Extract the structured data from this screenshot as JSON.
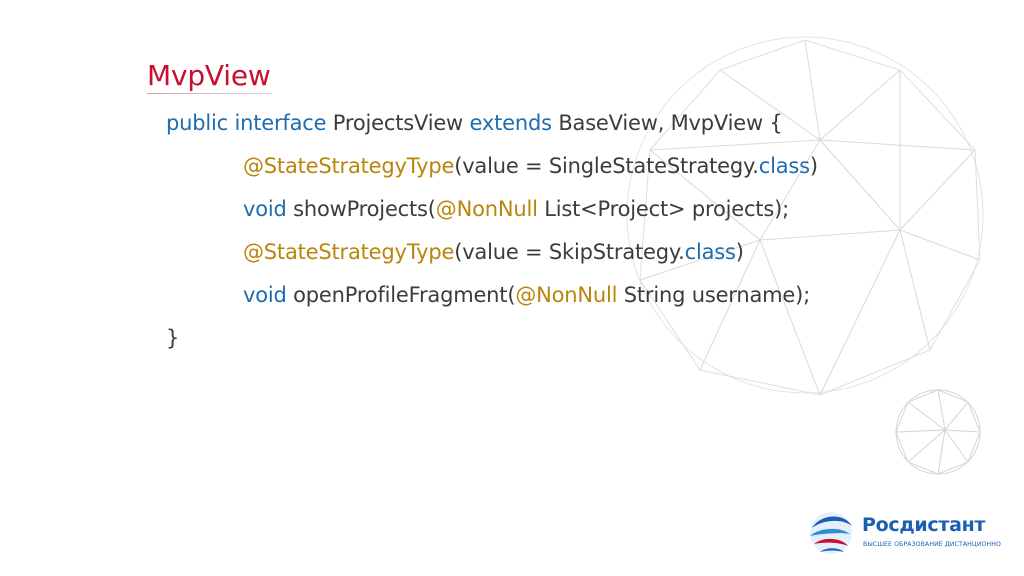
{
  "slide": {
    "title": "MvpView"
  },
  "code": {
    "lines": [
      [
        {
          "t": "public interface",
          "c": "kw"
        },
        {
          "t": " ProjectsView ",
          "c": "txt"
        },
        {
          "t": "extends",
          "c": "kw"
        },
        {
          "t": " BaseView, MvpView {",
          "c": "txt"
        }
      ],
      [
        {
          "t": "@StateStrategyType",
          "c": "ann"
        },
        {
          "t": "(value = SingleStateStrategy.",
          "c": "txt"
        },
        {
          "t": "class",
          "c": "kw"
        },
        {
          "t": ")",
          "c": "txt"
        }
      ],
      [
        {
          "t": "void",
          "c": "kw"
        },
        {
          "t": " showProjects(",
          "c": "txt"
        },
        {
          "t": "@NonNull",
          "c": "ann"
        },
        {
          "t": " List<Project> projects);",
          "c": "txt"
        }
      ],
      [
        {
          "t": "@StateStrategyType",
          "c": "ann"
        },
        {
          "t": "(value = SkipStrategy.",
          "c": "txt"
        },
        {
          "t": "class",
          "c": "kw"
        },
        {
          "t": ")",
          "c": "txt"
        }
      ],
      [
        {
          "t": "void",
          "c": "kw"
        },
        {
          "t": " openProfileFragment(",
          "c": "txt"
        },
        {
          "t": "@NonNull",
          "c": "ann"
        },
        {
          "t": " String username);",
          "c": "txt"
        }
      ],
      [
        {
          "t": "}",
          "c": "txt"
        }
      ]
    ]
  },
  "logo": {
    "name": "Росдистант",
    "tagline": "ВЫСШЕЕ ОБРАЗОВАНИЕ ДИСТАНЦИОННО",
    "icon": "globe-swirl-logo"
  },
  "colors": {
    "title": "#c8102e",
    "keyword": "#1f6db0",
    "annotation": "#b8860b",
    "text": "#3c3c3c",
    "brand": "#1b5fb0"
  }
}
